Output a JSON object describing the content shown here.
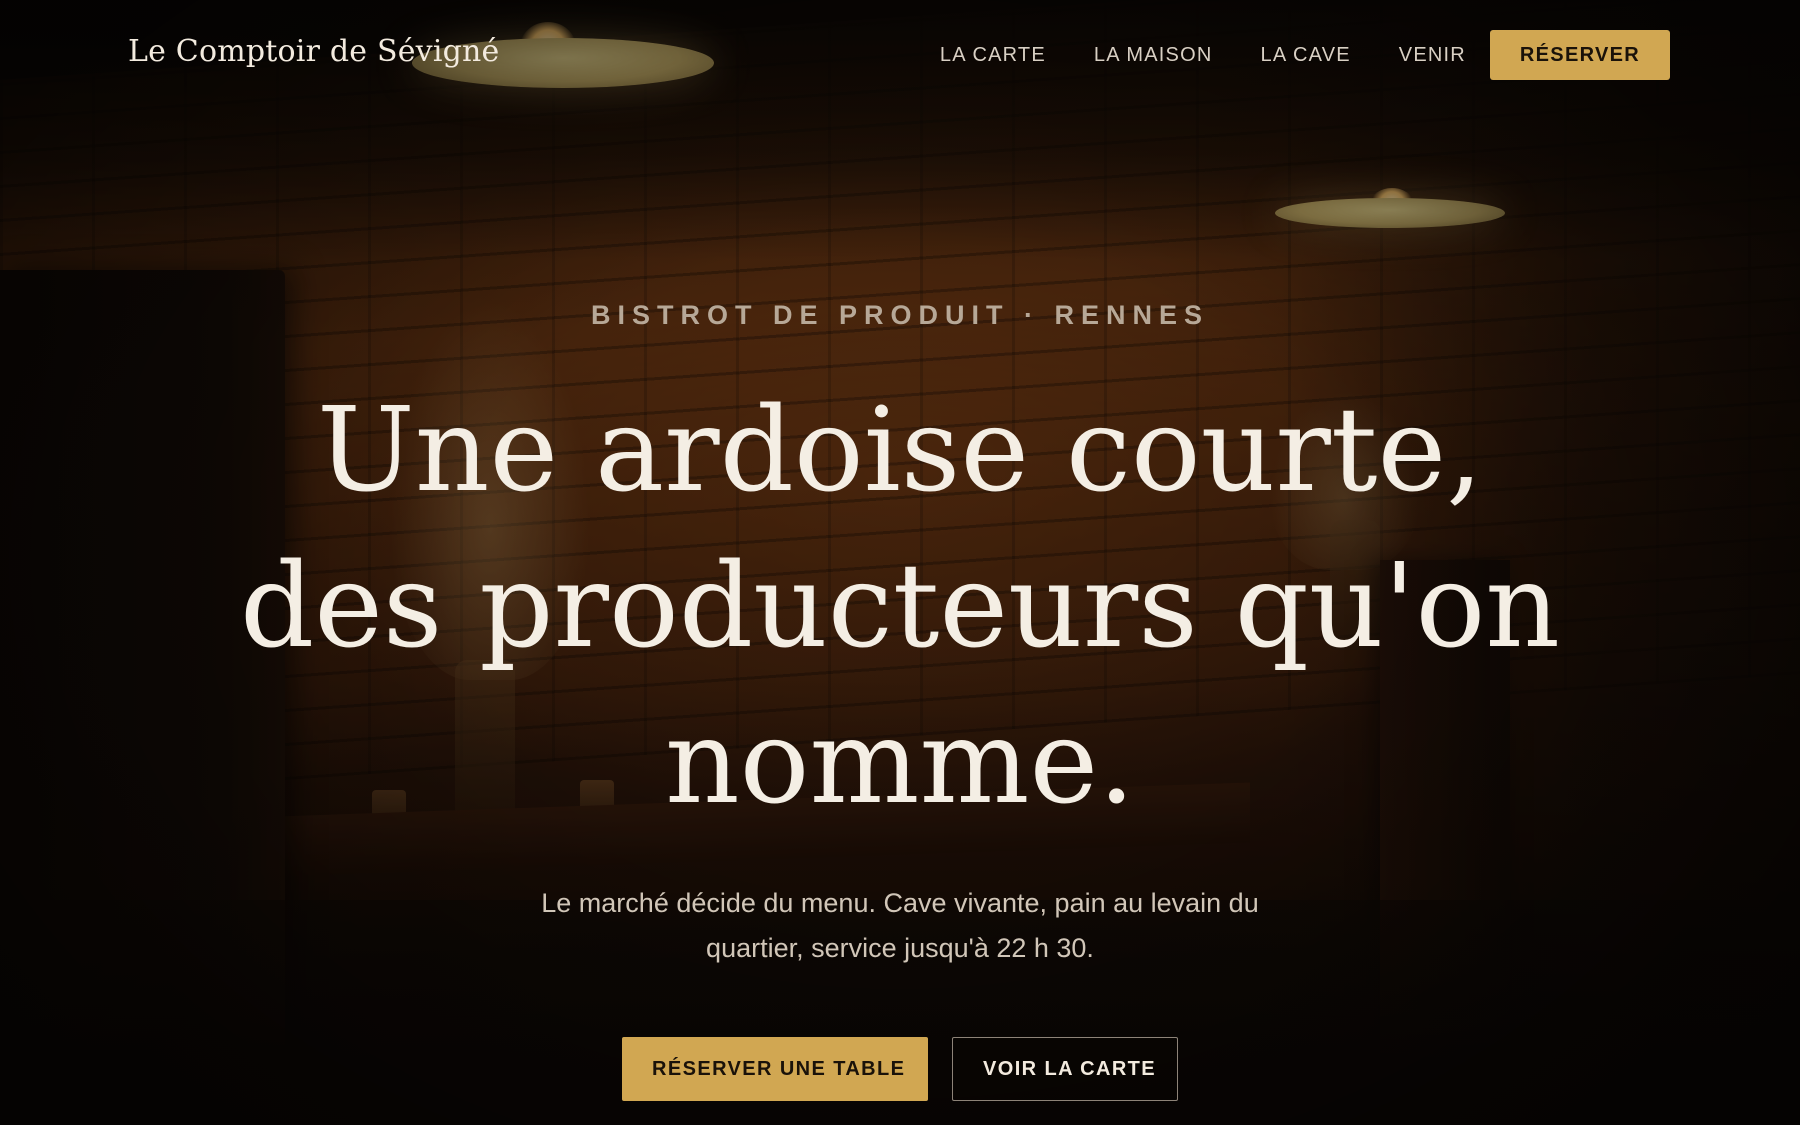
{
  "header": {
    "logo": "Le Comptoir de Sévigné",
    "nav": [
      {
        "label": "LA CARTE"
      },
      {
        "label": "LA MAISON"
      },
      {
        "label": "LA CAVE"
      },
      {
        "label": "VENIR"
      }
    ],
    "cta_label": "RÉSERVER"
  },
  "hero": {
    "eyebrow": "BISTROT DE PRODUIT · RENNES",
    "headline_lines": [
      "Une ardoise courte,",
      "des producteurs qu'on",
      "nomme."
    ],
    "subtitle": "Le marché décide du menu. Cave vivante, pain au levain du quartier, service jusqu'à 22 h 30.",
    "primary_cta": "RÉSERVER UNE TABLE",
    "secondary_cta": "VOIR LA CARTE"
  },
  "colors": {
    "accent": "#d1a752",
    "text_light": "#f4eee4",
    "background": "#0b0705"
  }
}
